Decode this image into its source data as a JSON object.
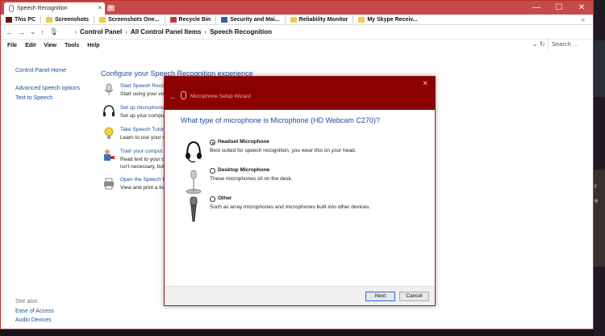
{
  "browser": {
    "tab_title": "Speech Recognition",
    "tab_close": "×",
    "new_tab": "+",
    "caption": {
      "minimize": "—",
      "maximize": "☐",
      "close": "✕"
    }
  },
  "bookmarks": [
    {
      "label": "This PC",
      "icon": "pc-icon"
    },
    {
      "label": "Screenshots",
      "icon": "folder-icon"
    },
    {
      "label": "Screenshots One...",
      "icon": "folder-icon"
    },
    {
      "label": "Recycle Bin",
      "icon": "recycle-bin-icon"
    },
    {
      "label": "Security and Mai...",
      "icon": "flag-icon"
    },
    {
      "label": "Reliability Monitor",
      "icon": "folder-icon"
    },
    {
      "label": "My Skype Receiv...",
      "icon": "folder-icon"
    }
  ],
  "bookmarks_more": "»",
  "address": {
    "crumbs": [
      "Control Panel",
      "All Control Panel Items",
      "Speech Recognition"
    ],
    "search_placeholder": "Search ..."
  },
  "menu": [
    "File",
    "Edit",
    "View",
    "Tools",
    "Help"
  ],
  "leftnav": {
    "home": "Control Panel Home",
    "advanced": "Advanced speech options",
    "tts": "Text to Speech"
  },
  "seealso": {
    "header": "See also",
    "ease": "Ease of Access",
    "audio": "Audio Devices"
  },
  "content": {
    "title": "Configure your Speech Recognition experience",
    "items": [
      {
        "link": "Start Speech Recogn",
        "desc": "Start using your voi"
      },
      {
        "link": "Set up microphone",
        "desc": "Set up your compu"
      },
      {
        "link": "Take Speech Tutori",
        "desc": "Learn to use your c"
      },
      {
        "link": "Train your comput",
        "desc": "Read text to your c",
        "desc2": "isn't necessary, but"
      },
      {
        "link": "Open the Speech R",
        "desc": "View and print a lis"
      }
    ]
  },
  "dialog": {
    "title": "Microphone Setup Wizard",
    "question": "What type of microphone is Microphone (HD Webcam C270)?",
    "options": [
      {
        "label": "Headset Microphone",
        "desc": "Best suited for speech recognition, you wear this on your head.",
        "selected": true
      },
      {
        "label": "Desktop Microphone",
        "desc": "These microphones sit on the desk.",
        "selected": false
      },
      {
        "label": "Other",
        "desc": "Such as array microphones and microphones built into other devices.",
        "selected": false
      }
    ],
    "next": "Next",
    "cancel": "Cancel"
  },
  "desktop_right": {
    "t1": "r",
    "t2": "e"
  },
  "colors": {
    "titlebar": "#c64a4a",
    "dialog_title": "#8b0000",
    "link": "#1a4f9c"
  }
}
